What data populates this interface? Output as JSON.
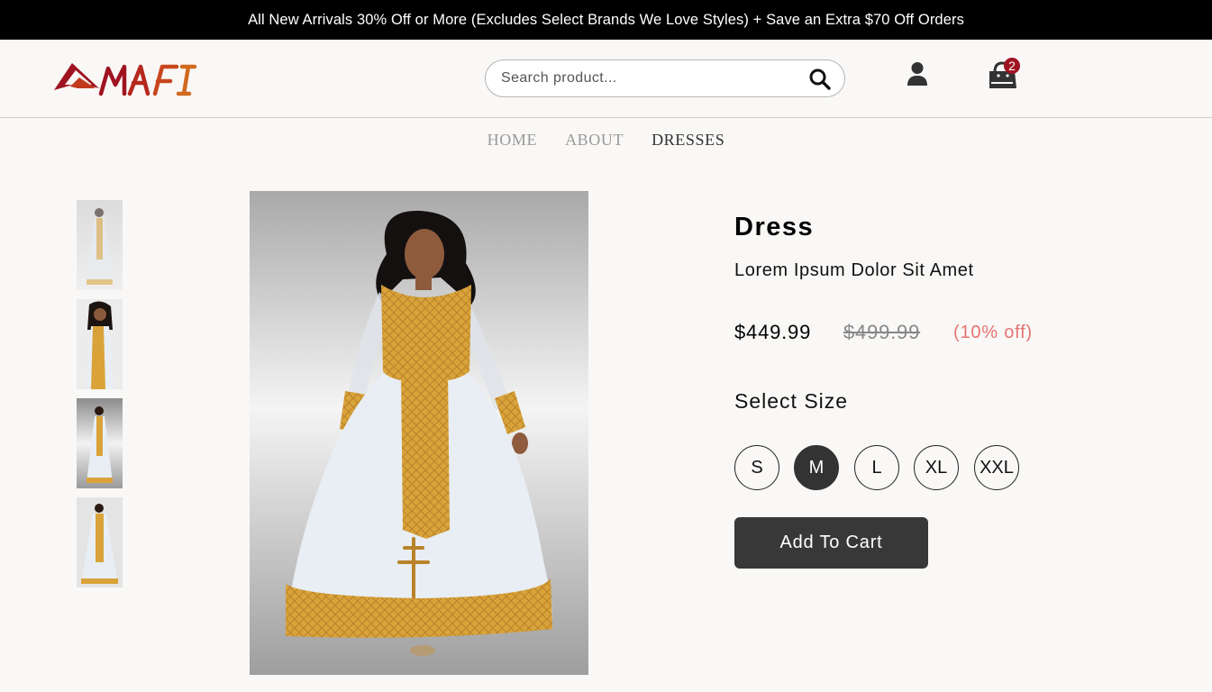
{
  "promo_banner": {
    "text": "All New Arrivals 30% Off or More (Excludes Select Brands We Love Styles) + Save an Extra $70 Off Orders"
  },
  "header": {
    "logo_text": "MAFI",
    "search": {
      "placeholder": "Search product...",
      "value": ""
    },
    "cart_count": "2",
    "icons": [
      "search-icon",
      "user-icon",
      "shopping-bag-icon"
    ]
  },
  "nav": {
    "items": [
      {
        "label": "HOME",
        "active": false
      },
      {
        "label": "ABOUT",
        "active": false
      },
      {
        "label": "DRESSES",
        "active": true
      }
    ]
  },
  "gallery": {
    "thumbnail_count": 4,
    "selected_index": 0
  },
  "product": {
    "title": "Dress",
    "subtitle": "Lorem Ipsum Dolor Sit Amet",
    "price": "$449.99",
    "old_price": "$499.99",
    "discount": "(10% off)",
    "size_label": "Select Size",
    "sizes": [
      {
        "label": "S",
        "selected": false
      },
      {
        "label": "M",
        "selected": true
      },
      {
        "label": "L",
        "selected": false
      },
      {
        "label": "XL",
        "selected": false
      },
      {
        "label": "XXL",
        "selected": false
      }
    ],
    "add_to_cart_label": "Add To Cart"
  },
  "colors": {
    "brand_red": "#a01321",
    "brand_orange": "#d2691e",
    "accent_dark": "#383838",
    "discount": "#e57373",
    "dress_gold": "#d9a33a",
    "dress_white": "#e8eef3"
  }
}
